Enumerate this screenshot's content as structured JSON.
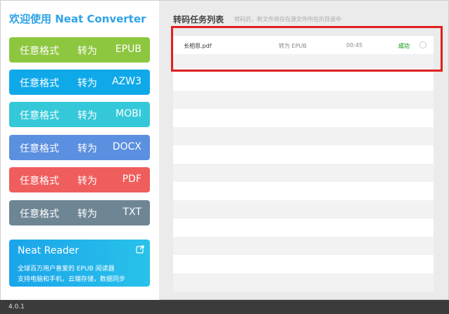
{
  "app": {
    "title": "欢迎使用 Neat Converter",
    "version": "4.0.1"
  },
  "sidebar": {
    "buttons": [
      {
        "from": "任意格式",
        "to": "转为",
        "format": "EPUB",
        "color": "#8dc63f"
      },
      {
        "from": "任意格式",
        "to": "转为",
        "format": "AZW3",
        "color": "#0fa9ea"
      },
      {
        "from": "任意格式",
        "to": "转为",
        "format": "MOBI",
        "color": "#35c8d9"
      },
      {
        "from": "任意格式",
        "to": "转为",
        "format": "DOCX",
        "color": "#5b8fe0"
      },
      {
        "from": "任意格式",
        "to": "转为",
        "format": "PDF",
        "color": "#ef5d5d"
      },
      {
        "from": "任意格式",
        "to": "转为",
        "format": "TXT",
        "color": "#6e8594"
      }
    ],
    "reader": {
      "title": "Neat Reader",
      "line1": "全球百万用户喜爱的 EPUB 阅读器",
      "line2": "支持电脑和手机，云端存储，数据同步"
    }
  },
  "main": {
    "title": "转码任务列表",
    "subtitle": "转码后，新文件将存在源文件所在的目录中",
    "tasks": [
      {
        "name": "长相思.pdf",
        "format": "转为 EPUB",
        "time": "00:45",
        "status": "成功"
      }
    ]
  }
}
